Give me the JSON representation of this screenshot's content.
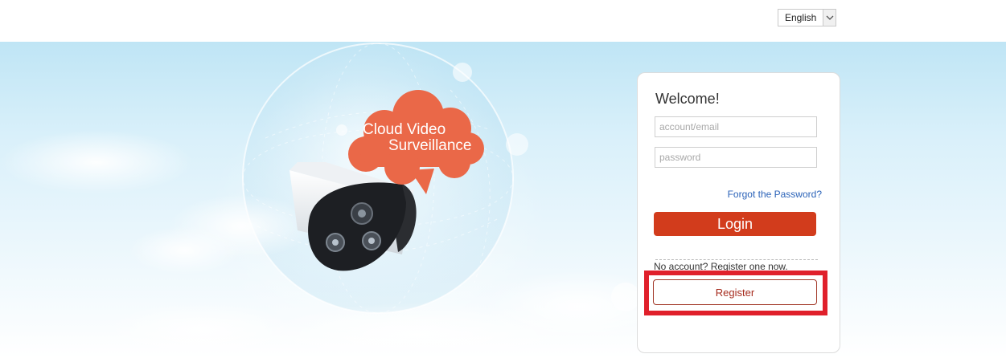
{
  "header": {
    "language": {
      "selected": "English"
    }
  },
  "hero": {
    "bubble_line1": "Cloud Video",
    "bubble_line2": "Surveillance"
  },
  "login": {
    "title": "Welcome!",
    "account_placeholder": "account/email",
    "password_placeholder": "password",
    "forgot_link": "Forgot the Password?",
    "login_button": "Login",
    "no_account_text": "No account? Register one now.",
    "register_button": "Register"
  },
  "colors": {
    "login_button": "#d23c1c",
    "forgot_link": "#2a62b8",
    "highlight": "#e0202b",
    "bubble": "#ea6848"
  }
}
